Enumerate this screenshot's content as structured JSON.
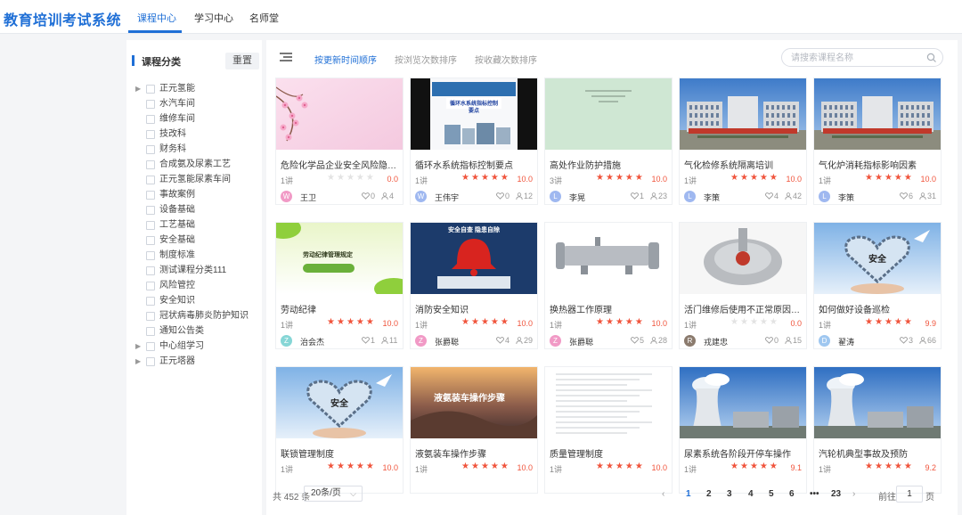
{
  "header": {
    "logo": "教育培训考试系统",
    "tabs": [
      {
        "label": "课程中心",
        "active": true
      },
      {
        "label": "学习中心",
        "active": false
      },
      {
        "label": "名师堂",
        "active": false
      }
    ],
    "accent_color": "#1f6fd6"
  },
  "sidebar": {
    "title": "课程分类",
    "reset_label": "重置",
    "items": [
      {
        "label": "正元氢能",
        "expandable": true
      },
      {
        "label": "水汽车间",
        "expandable": false
      },
      {
        "label": "维修车间",
        "expandable": false
      },
      {
        "label": "技改科",
        "expandable": false
      },
      {
        "label": "财务科",
        "expandable": false
      },
      {
        "label": "合成氨及尿素工艺",
        "expandable": false
      },
      {
        "label": "正元氢能尿素车间",
        "expandable": false
      },
      {
        "label": "事故案例",
        "expandable": false
      },
      {
        "label": "设备基础",
        "expandable": false
      },
      {
        "label": "工艺基础",
        "expandable": false
      },
      {
        "label": "安全基础",
        "expandable": false
      },
      {
        "label": "制度标准",
        "expandable": false
      },
      {
        "label": "测试课程分类111",
        "expandable": false
      },
      {
        "label": "风险管控",
        "expandable": false
      },
      {
        "label": "安全知识",
        "expandable": false
      },
      {
        "label": "冠状病毒肺炎防护知识",
        "expandable": false
      },
      {
        "label": "通知公告类",
        "expandable": false
      },
      {
        "label": "中心组学习",
        "expandable": true
      },
      {
        "label": "正元塔器",
        "expandable": true
      }
    ]
  },
  "toolbar": {
    "sort_options": [
      {
        "label": "按更新时间顺序",
        "active": true
      },
      {
        "label": "按浏览次数排序",
        "active": false
      },
      {
        "label": "按收藏次数排序",
        "active": false
      }
    ],
    "search_placeholder": "请搜索课程名称"
  },
  "courses": [
    {
      "title": "危险化学品企业安全风险隐患排...",
      "lessons": "1讲",
      "rating": 0,
      "score": "0.0",
      "author": "王卫",
      "avatar_letter": "W",
      "avatar_color": "#f19ac6",
      "likes": "0",
      "views": "4",
      "thumb": "pink-flowers"
    },
    {
      "title": "循环水系统指标控制要点",
      "lessons": "1讲",
      "rating": 5,
      "score": "10.0",
      "author": "王伟宇",
      "avatar_letter": "W",
      "avatar_color": "#9fb8f0",
      "likes": "0",
      "views": "12",
      "thumb": "water-slide",
      "thumb_text": "循环水系统指标控制要点"
    },
    {
      "title": "高处作业防护措施",
      "lessons": "3讲",
      "rating": 5,
      "score": "10.0",
      "author": "李晃",
      "avatar_letter": "L",
      "avatar_color": "#9fb8f0",
      "likes": "1",
      "views": "23",
      "thumb": "green-doc"
    },
    {
      "title": "气化检修系统隔离培训",
      "lessons": "1讲",
      "rating": 5,
      "score": "10.0",
      "author": "李策",
      "avatar_letter": "L",
      "avatar_color": "#9fb8f0",
      "likes": "4",
      "views": "42",
      "thumb": "building"
    },
    {
      "title": "气化炉消耗指标影响因素",
      "lessons": "1讲",
      "rating": 5,
      "score": "10.0",
      "author": "李策",
      "avatar_letter": "L",
      "avatar_color": "#9fb8f0",
      "likes": "6",
      "views": "31",
      "thumb": "building"
    },
    {
      "title": "劳动纪律",
      "lessons": "1讲",
      "rating": 5,
      "score": "10.0",
      "author": "治会杰",
      "avatar_letter": "Z",
      "avatar_color": "#86d6d6",
      "likes": "1",
      "views": "11",
      "thumb": "green-leaves",
      "thumb_text": "劳动纪律管理规定"
    },
    {
      "title": "消防安全知识",
      "lessons": "1讲",
      "rating": 5,
      "score": "10.0",
      "author": "张爵聪",
      "avatar_letter": "Z",
      "avatar_color": "#f19ac6",
      "likes": "4",
      "views": "29",
      "thumb": "bell",
      "thumb_text": "安全自查 隐患自除"
    },
    {
      "title": "换热器工作原理",
      "lessons": "1讲",
      "rating": 5,
      "score": "10.0",
      "author": "张爵聪",
      "avatar_letter": "Z",
      "avatar_color": "#f19ac6",
      "likes": "5",
      "views": "28",
      "thumb": "exchanger"
    },
    {
      "title": "活门维修后使用不正常原因及措施",
      "lessons": "1讲",
      "rating": 0,
      "score": "0.0",
      "author": "戎建忠",
      "avatar_letter": "R",
      "avatar_color": "#8b7b6e",
      "likes": "0",
      "views": "15",
      "thumb": "valve"
    },
    {
      "title": "如何做好设备巡检",
      "lessons": "1讲",
      "rating": 5,
      "score": "9.9",
      "author": "翟涛",
      "avatar_letter": "D",
      "avatar_color": "#9fc7f0",
      "likes": "3",
      "views": "66",
      "thumb": "heart-safety",
      "thumb_text": "安全"
    },
    {
      "title": "联锁管理制度",
      "lessons": "1讲",
      "rating": 5,
      "score": "10.0",
      "author": "",
      "avatar_letter": "",
      "avatar_color": "",
      "likes": "",
      "views": "",
      "thumb": "heart-safety",
      "thumb_text": "安全"
    },
    {
      "title": "液氨装车操作步骤",
      "lessons": "1讲",
      "rating": 5,
      "score": "10.0",
      "author": "",
      "avatar_letter": "",
      "avatar_color": "",
      "likes": "",
      "views": "",
      "thumb": "sunset",
      "thumb_text": "液氨装车操作步骤"
    },
    {
      "title": "质量管理制度",
      "lessons": "1讲",
      "rating": 5,
      "score": "10.0",
      "author": "",
      "avatar_letter": "",
      "avatar_color": "",
      "likes": "",
      "views": "",
      "thumb": "doc-page"
    },
    {
      "title": "尿素系统各阶段开停车操作",
      "lessons": "1讲",
      "rating": 4.5,
      "score": "9.1",
      "author": "",
      "avatar_letter": "",
      "avatar_color": "",
      "likes": "",
      "views": "",
      "thumb": "cooling-tower"
    },
    {
      "title": "汽轮机典型事故及预防",
      "lessons": "1讲",
      "rating": 4.5,
      "score": "9.2",
      "author": "",
      "avatar_letter": "",
      "avatar_color": "",
      "likes": "",
      "views": "",
      "thumb": "cooling-tower"
    }
  ],
  "pagination": {
    "total_label": "共 452 条",
    "page_size": "20条/页",
    "pages": [
      "1",
      "2",
      "3",
      "4",
      "5",
      "6",
      "•••",
      "23"
    ],
    "current": "1",
    "prev": "‹",
    "next": "›",
    "goto_prefix": "前往",
    "goto_value": "1",
    "goto_suffix": "页"
  }
}
